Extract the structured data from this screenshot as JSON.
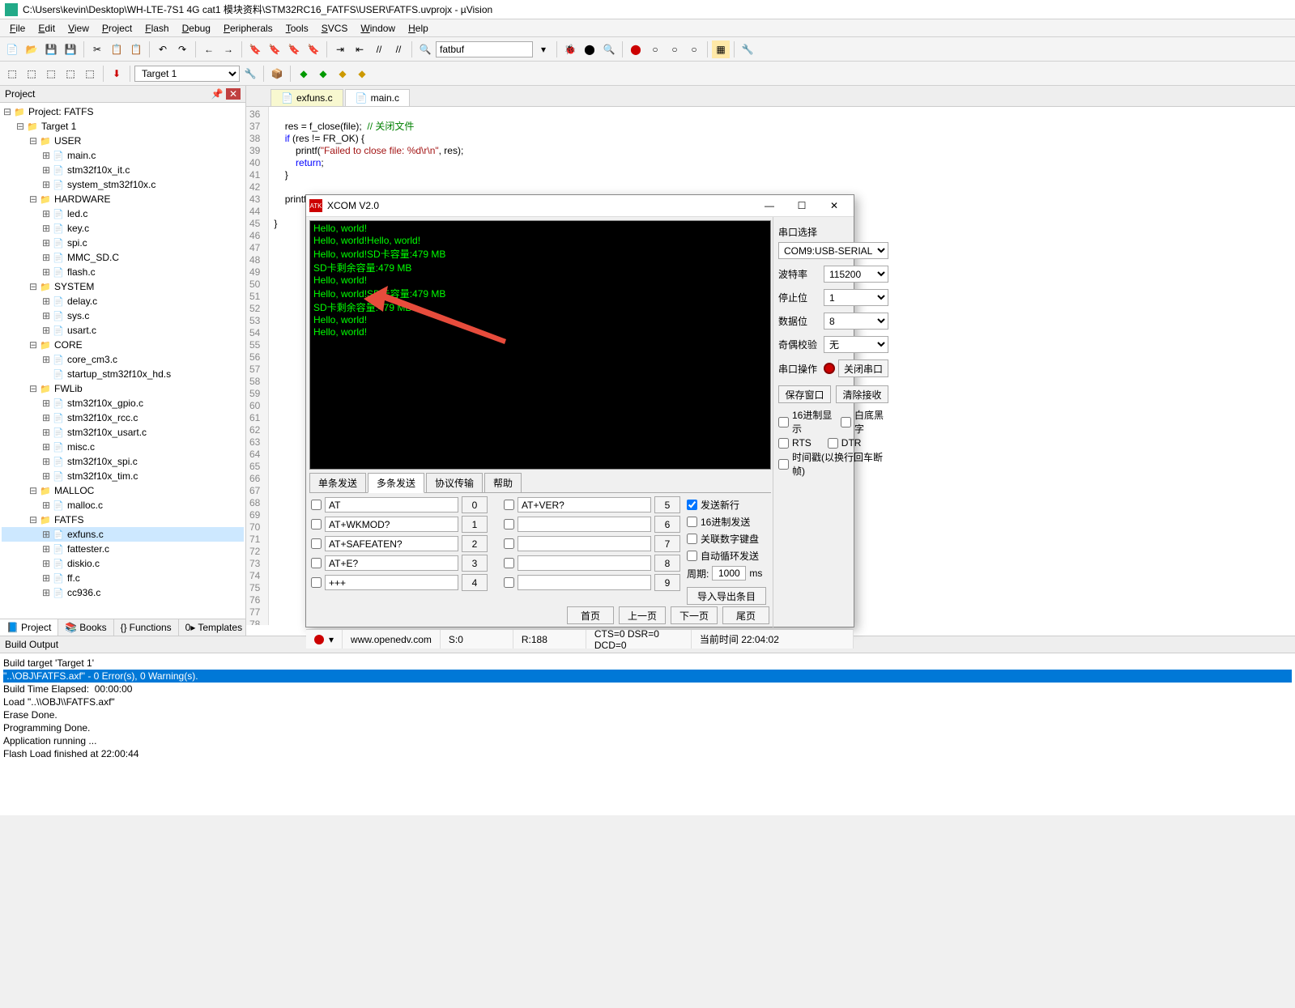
{
  "window": {
    "title": "C:\\Users\\kevin\\Desktop\\WH-LTE-7S1 4G cat1 模块资料\\STM32RC16_FATFS\\USER\\FATFS.uvprojx - µVision"
  },
  "menu": [
    "File",
    "Edit",
    "View",
    "Project",
    "Flash",
    "Debug",
    "Peripherals",
    "Tools",
    "SVCS",
    "Window",
    "Help"
  ],
  "toolbar": {
    "search_value": "fatbuf",
    "target": "Target 1"
  },
  "project_panel": {
    "title": "Project",
    "tree": [
      {
        "d": 0,
        "exp": "-",
        "icon": "project",
        "label": "Project: FATFS"
      },
      {
        "d": 1,
        "exp": "-",
        "icon": "target",
        "label": "Target 1"
      },
      {
        "d": 2,
        "exp": "-",
        "icon": "folder",
        "label": "USER"
      },
      {
        "d": 3,
        "exp": "+",
        "icon": "file",
        "label": "main.c"
      },
      {
        "d": 3,
        "exp": "+",
        "icon": "file",
        "label": "stm32f10x_it.c"
      },
      {
        "d": 3,
        "exp": "+",
        "icon": "file",
        "label": "system_stm32f10x.c"
      },
      {
        "d": 2,
        "exp": "-",
        "icon": "folder",
        "label": "HARDWARE"
      },
      {
        "d": 3,
        "exp": "+",
        "icon": "file",
        "label": "led.c"
      },
      {
        "d": 3,
        "exp": "+",
        "icon": "file",
        "label": "key.c"
      },
      {
        "d": 3,
        "exp": "+",
        "icon": "file",
        "label": "spi.c"
      },
      {
        "d": 3,
        "exp": "+",
        "icon": "file",
        "label": "MMC_SD.C"
      },
      {
        "d": 3,
        "exp": "+",
        "icon": "file",
        "label": "flash.c"
      },
      {
        "d": 2,
        "exp": "-",
        "icon": "folder",
        "label": "SYSTEM"
      },
      {
        "d": 3,
        "exp": "+",
        "icon": "file",
        "label": "delay.c"
      },
      {
        "d": 3,
        "exp": "+",
        "icon": "file",
        "label": "sys.c"
      },
      {
        "d": 3,
        "exp": "+",
        "icon": "file",
        "label": "usart.c"
      },
      {
        "d": 2,
        "exp": "-",
        "icon": "folder",
        "label": "CORE"
      },
      {
        "d": 3,
        "exp": "+",
        "icon": "file",
        "label": "core_cm3.c"
      },
      {
        "d": 3,
        "exp": "",
        "icon": "file",
        "label": "startup_stm32f10x_hd.s"
      },
      {
        "d": 2,
        "exp": "-",
        "icon": "folder",
        "label": "FWLib"
      },
      {
        "d": 3,
        "exp": "+",
        "icon": "file",
        "label": "stm32f10x_gpio.c"
      },
      {
        "d": 3,
        "exp": "+",
        "icon": "file",
        "label": "stm32f10x_rcc.c"
      },
      {
        "d": 3,
        "exp": "+",
        "icon": "file",
        "label": "stm32f10x_usart.c"
      },
      {
        "d": 3,
        "exp": "+",
        "icon": "file",
        "label": "misc.c"
      },
      {
        "d": 3,
        "exp": "+",
        "icon": "file",
        "label": "stm32f10x_spi.c"
      },
      {
        "d": 3,
        "exp": "+",
        "icon": "file",
        "label": "stm32f10x_tim.c"
      },
      {
        "d": 2,
        "exp": "-",
        "icon": "folder",
        "label": "MALLOC"
      },
      {
        "d": 3,
        "exp": "+",
        "icon": "file",
        "label": "malloc.c"
      },
      {
        "d": 2,
        "exp": "-",
        "icon": "folder",
        "label": "FATFS"
      },
      {
        "d": 3,
        "exp": "+",
        "icon": "file",
        "label": "exfuns.c",
        "sel": true
      },
      {
        "d": 3,
        "exp": "+",
        "icon": "file",
        "label": "fattester.c"
      },
      {
        "d": 3,
        "exp": "+",
        "icon": "file",
        "label": "diskio.c"
      },
      {
        "d": 3,
        "exp": "+",
        "icon": "file",
        "label": "ff.c"
      },
      {
        "d": 3,
        "exp": "+",
        "icon": "file",
        "label": "cc936.c"
      }
    ],
    "bottom_tabs": [
      {
        "icon": "📘",
        "label": "Project",
        "active": true
      },
      {
        "icon": "📚",
        "label": "Books"
      },
      {
        "icon": "{}",
        "label": "Functions"
      },
      {
        "icon": "0▸",
        "label": "Templates"
      }
    ]
  },
  "editor": {
    "tabs": [
      {
        "label": "exfuns.c",
        "active": false
      },
      {
        "label": "main.c",
        "active": true
      }
    ],
    "first_line": 36,
    "lines": [
      "",
      "    res = f_close(file);  <span class='cm'>// 关闭文件</span>",
      "    <span class='kw'>if</span> (res != FR_OK) {",
      "        printf(<span class='str'>\"Failed to close file: %d\\r\\n\"</span>, res);",
      "        <span class='kw'>return</span>;",
      "    }",
      "",
      "    printf(<span class='str'>\"Write successfully, %u bytes written\\r\\n\"</span>, bw);",
      "",
      "}",
      "",
      "",
      "",
      "",
      "",
      "",
      "",
      "",
      "",
      "",
      "",
      "",
      "",
      "",
      "",
      "",
      "",
      "",
      "",
      "",
      "",
      "",
      "",
      "",
      "",
      "",
      "",
      "",
      "",
      "",
      "",
      "",
      "",
      "",
      "",
      "",
      "",
      "",
      "",
      ""
    ]
  },
  "build": {
    "title": "Build Output",
    "lines": [
      {
        "t": "Build target 'Target 1'"
      },
      {
        "t": "\"..\\OBJ\\FATFS.axf\" - 0 Error(s), 0 Warning(s).",
        "sel": true
      },
      {
        "t": "Build Time Elapsed:  00:00:00"
      },
      {
        "t": "Load \"..\\\\OBJ\\\\FATFS.axf\""
      },
      {
        "t": "Erase Done."
      },
      {
        "t": "Programming Done."
      },
      {
        "t": "Application running ..."
      },
      {
        "t": "Flash Load finished at 22:00:44"
      }
    ]
  },
  "xcom": {
    "title": "XCOM V2.0",
    "terminal": "Hello, world!\nHello, world!Hello, world!\nHello, world!SD卡容量:479 MB\nSD卡剩余容量:479 MB\nHello, world!\nHello, world!SD卡容量:479 MB\nSD卡剩余容量:479 MB\nHello, world!\nHello, world!",
    "serial": {
      "section": "串口选择",
      "port": "COM9:USB-SERIAL",
      "baud_label": "波特率",
      "baud": "115200",
      "stop_label": "停止位",
      "stop": "1",
      "data_label": "数据位",
      "data": "8",
      "parity_label": "奇偶校验",
      "parity": "无",
      "op_label": "串口操作",
      "op_btn": "关闭串口",
      "save_btn": "保存窗口",
      "clear_btn": "清除接收",
      "hex_disp": "16进制显示",
      "white_bg": "白底黑字",
      "rts": "RTS",
      "dtr": "DTR",
      "timestamp": "时间戳(以换行回车断帧)"
    },
    "tabs": [
      "单条发送",
      "多条发送",
      "协议传输",
      "帮助"
    ],
    "active_tab": 1,
    "cmds": [
      [
        {
          "chk": false,
          "v": "AT"
        },
        {
          "n": "0"
        },
        {
          "chk": false,
          "v": "AT+VER?"
        },
        {
          "n": "5"
        }
      ],
      [
        {
          "chk": false,
          "v": "AT+WKMOD?"
        },
        {
          "n": "1"
        },
        {
          "chk": false,
          "v": ""
        },
        {
          "n": "6"
        }
      ],
      [
        {
          "chk": false,
          "v": "AT+SAFEATEN?"
        },
        {
          "n": "2"
        },
        {
          "chk": false,
          "v": ""
        },
        {
          "n": "7"
        }
      ],
      [
        {
          "chk": false,
          "v": "AT+E?"
        },
        {
          "n": "3"
        },
        {
          "chk": false,
          "v": ""
        },
        {
          "n": "8"
        }
      ],
      [
        {
          "chk": false,
          "v": "+++"
        },
        {
          "n": "4"
        },
        {
          "chk": false,
          "v": ""
        },
        {
          "n": "9"
        }
      ]
    ],
    "nav": {
      "home": "首页",
      "prev": "上一页",
      "next": "下一页",
      "last": "尾页"
    },
    "opts": {
      "send_newline": "发送新行",
      "hex_send": "16进制发送",
      "numpad": "关联数字键盘",
      "loop": "自动循环发送",
      "period_label": "周期:",
      "period_val": "1000",
      "period_unit": "ms",
      "import": "导入导出条目"
    },
    "status": {
      "url": "www.openedv.com",
      "s": "S:0",
      "r": "R:188",
      "cts": "CTS=0 DSR=0 DCD=0",
      "time": "当前时间 22:04:02"
    }
  }
}
